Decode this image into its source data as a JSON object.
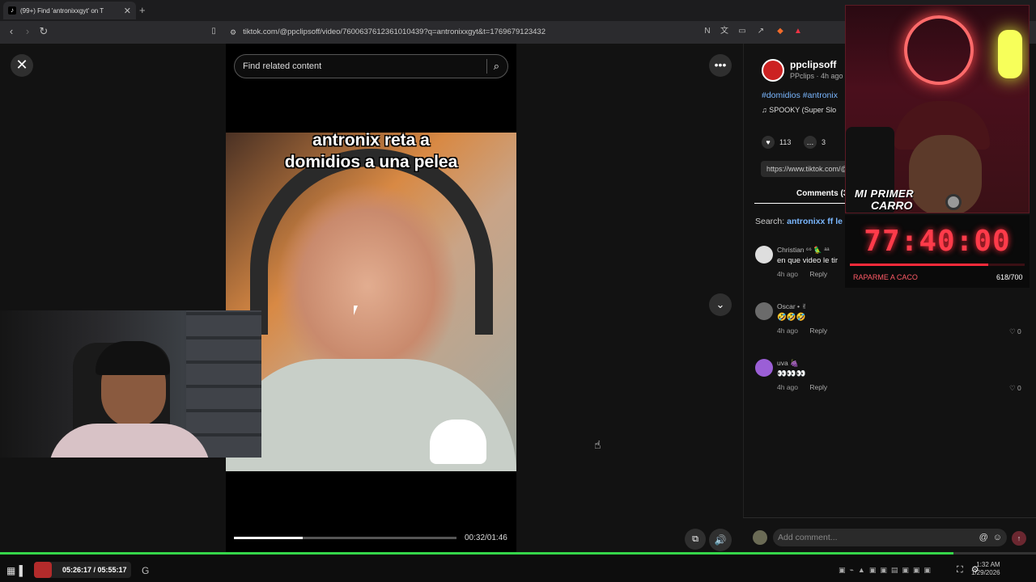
{
  "browser": {
    "tab_title": "(99+) Find 'antronixxgyt' on T",
    "tab_close": "✕",
    "new_tab": "+",
    "url": "tiktok.com/@ppclipsoff/video/7600637612361010439?q=antronixxgyt&t=1769679123432"
  },
  "search": {
    "placeholder": "Find related content"
  },
  "video": {
    "caption_line1": "antronix reta a",
    "caption_line2": "domidios a una pelea",
    "time": "00:32/01:46",
    "progress": 0.31
  },
  "post": {
    "username": "ppclipsoff",
    "subtitle": "PPclips · 4h ago",
    "hashtags": "#domidios #antronix",
    "music": "♫  SPOOKY (Super Slo",
    "likes": "113",
    "comments": "3",
    "link": "https://www.tiktok.com/@ppclipsoff/video",
    "comments_tab": "Comments (3",
    "search_label": "Search:",
    "search_term": "antronixx ff le"
  },
  "comments": [
    {
      "name": "Christian ⁶⁶ 🦜 ᵃᵃ",
      "text": "en que video le tir",
      "time": "4h ago",
      "reply": "Reply",
      "likes": "",
      "avatar_color": "#dedede"
    },
    {
      "name": "Oscar • ✌",
      "text": "🤣🤣🤣",
      "time": "4h ago",
      "reply": "Reply",
      "likes": "0",
      "avatar_color": "#6b6b6b"
    },
    {
      "name": "uva 🍇",
      "text": "👀👀👀",
      "time": "4h ago",
      "reply": "Reply",
      "likes": "0",
      "avatar_color": "#9b5fd6"
    }
  ],
  "add_comment": {
    "placeholder": "Add comment...",
    "at": "@",
    "emoji": "☺",
    "send": "↑"
  },
  "overlay": {
    "badge_line1": "MI PRIMER",
    "badge_line2": "CARRO",
    "timer": "77:40:00",
    "timer_progress": 0.79,
    "goal_label": "RAPARME A CACO",
    "goal_count": "618/700"
  },
  "taskbar": {
    "media_time": "05:26:17 / 05:55:17",
    "clock_time": "1:32 AM",
    "clock_date": "1/29/2026"
  },
  "stream_progress": 0.92,
  "colors": {
    "accent_link": "#7ab7ff",
    "timer_red": "#ff3b4a",
    "stream_green": "#35d64a"
  }
}
